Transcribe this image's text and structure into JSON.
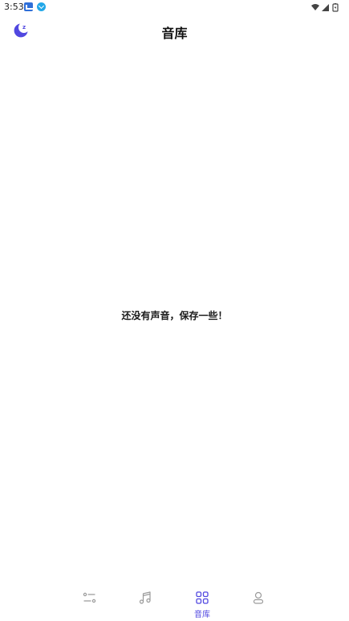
{
  "status_bar": {
    "time": "3:53",
    "icons": [
      "notification-app-icon",
      "download-icon",
      "wifi-icon",
      "signal-icon",
      "battery-icon"
    ]
  },
  "header": {
    "title": "音库",
    "left_icon": "moon-sleep-icon"
  },
  "main": {
    "empty_message": "还没有声音，保存一些！"
  },
  "bottom_nav": {
    "items": [
      {
        "icon": "mixer-icon",
        "label": "",
        "active": false
      },
      {
        "icon": "music-note-icon",
        "label": "",
        "active": false
      },
      {
        "icon": "grid-icon",
        "label": "音库",
        "active": true
      },
      {
        "icon": "profile-icon",
        "label": "",
        "active": false
      }
    ]
  },
  "colors": {
    "accent": "#5148e0",
    "inactive_icon": "#9a9a9a",
    "text": "#111111",
    "background": "#ffffff"
  }
}
